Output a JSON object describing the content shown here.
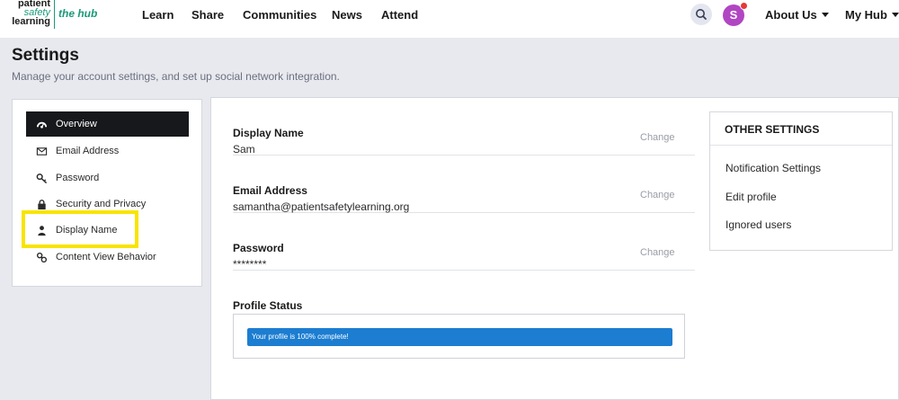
{
  "brand": {
    "logo_line1": "patient",
    "logo_line2": "safety",
    "logo_line3": "learning",
    "logo_tag": "the hub",
    "color": "#1a9a7a"
  },
  "nav": {
    "items": [
      "Learn",
      "Share",
      "Communities",
      "News",
      "Attend"
    ],
    "search_icon": "search-icon",
    "avatar_letter": "S",
    "about_label": "About Us",
    "myhub_label": "My Hub"
  },
  "page": {
    "title": "Settings",
    "subtitle": "Manage your account settings, and set up social network integration."
  },
  "menu": {
    "items": [
      {
        "label": "Overview",
        "icon": "dashboard-icon",
        "active": true
      },
      {
        "label": "Email Address",
        "icon": "envelope-icon",
        "active": false
      },
      {
        "label": "Password",
        "icon": "key-icon",
        "active": false
      },
      {
        "label": "Security and Privacy",
        "icon": "lock-icon",
        "active": false
      },
      {
        "label": "Display Name",
        "icon": "user-icon",
        "active": false
      },
      {
        "label": "Content View Behavior",
        "icon": "link-icon",
        "active": false
      }
    ]
  },
  "fields": [
    {
      "label": "Display Name",
      "value": "Sam",
      "action": "Change"
    },
    {
      "label": "Email Address",
      "value": "samantha@patientsafetylearning.org",
      "action": "Change"
    },
    {
      "label": "Password",
      "value": "********",
      "action": "Change"
    }
  ],
  "profile_status": {
    "label": "Profile Status",
    "text": "Your profile is 100% complete!",
    "percent": 100
  },
  "other_settings": {
    "title": "OTHER SETTINGS",
    "links": [
      "Notification Settings",
      "Edit profile",
      "Ignored users"
    ]
  },
  "colors": {
    "accent": "#1c7dd1",
    "avatar": "#b146c2",
    "highlight": "#f9e300",
    "active_menu": "#17181c"
  }
}
